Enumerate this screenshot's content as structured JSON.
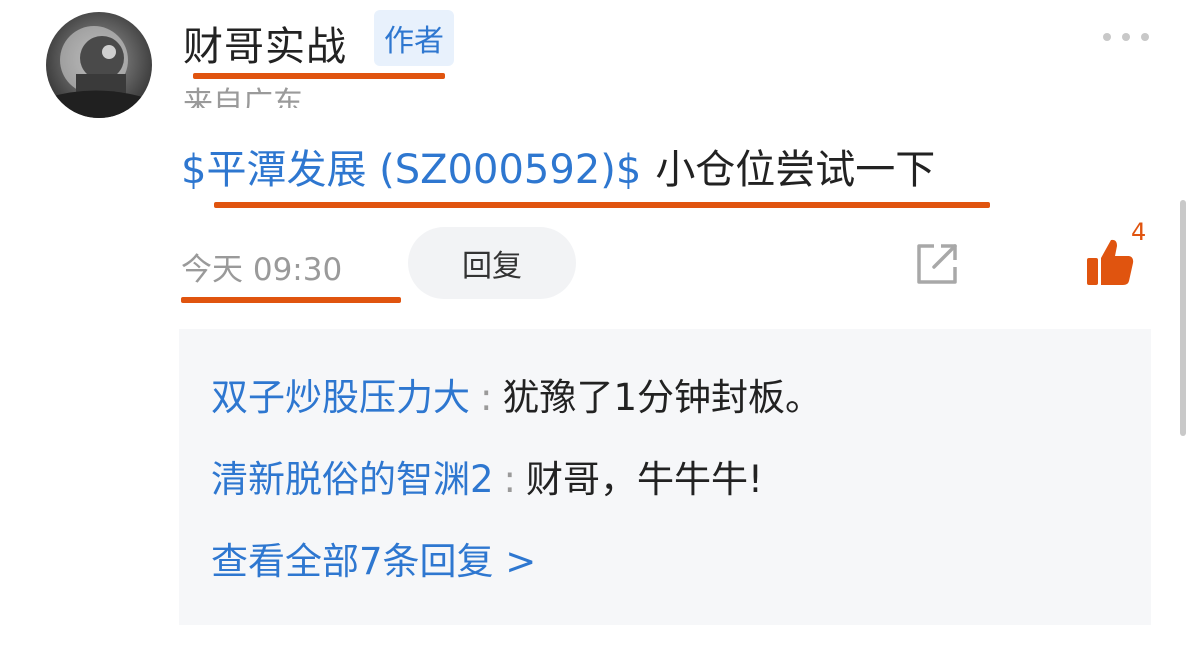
{
  "author": {
    "name": "财哥实战",
    "badge": "作者",
    "location": "来自广东"
  },
  "post": {
    "stock_link": "$平潭发展 (SZ000592)$",
    "text": "小仓位尝试一下"
  },
  "actions": {
    "timestamp": "今天 09:30",
    "reply_label": "回复",
    "like_count": "4"
  },
  "replies": [
    {
      "user": "双子炒股压力大",
      "colon": ":",
      "text": "犹豫了1分钟封板。"
    },
    {
      "user": "清新脱俗的智渊2",
      "colon": ":",
      "text": "财哥，牛牛牛!"
    }
  ],
  "view_all": "查看全部7条回复 >",
  "icons": {
    "avatar": "avatar-image",
    "more": "more-dots-icon",
    "share": "share-icon",
    "like": "thumbs-up-icon"
  },
  "colors": {
    "link": "#2e77d0",
    "accent": "#e0540f",
    "muted": "#9a9a9a",
    "reply_box": "#f6f7f9"
  }
}
